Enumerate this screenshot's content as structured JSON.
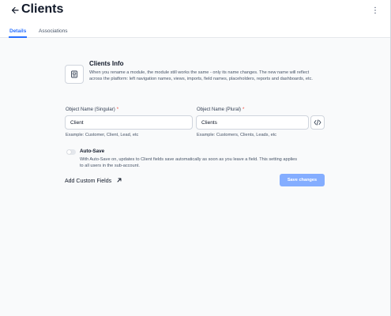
{
  "header": {
    "title": "Clients",
    "back_icon": "arrow-left-icon",
    "menu_icon": "kebab-vertical-icon"
  },
  "tabs": [
    {
      "label": "Details",
      "active": true
    },
    {
      "label": "Associations",
      "active": false
    }
  ],
  "info": {
    "icon": "module-icon",
    "title": "Clients Info",
    "description": "When you rename a module, the module still works the same - only its name changes. The new name will reflect across the platform: left navigation names, views, imports, field names, placeholders, reports and dashboards, etc."
  },
  "singular": {
    "label": "Object Name (Singular)",
    "required_mark": "*",
    "value": "Client",
    "helper": "Example: Customer, Client, Lead, etc"
  },
  "plural": {
    "label": "Object Name (Plural)",
    "required_mark": "*",
    "value": "Clients",
    "helper": "Example: Customers, Clients, Leads, etc",
    "code_icon": "code-brackets-icon"
  },
  "autosave": {
    "label": "Auto-Save",
    "enabled": false,
    "description": "With Auto-Save on, updates to Client fields save automatically as soon as you leave a field. This setting applies to all users in the sub-account."
  },
  "custom_fields": {
    "label": "Add Custom Fields",
    "icon": "arrow-up-right-icon"
  },
  "save_button": {
    "label": "Save changes"
  },
  "colors": {
    "accent": "#2970ff",
    "save_disabled": "#84adff",
    "required": "#f04438",
    "background": "#f9fafb"
  }
}
